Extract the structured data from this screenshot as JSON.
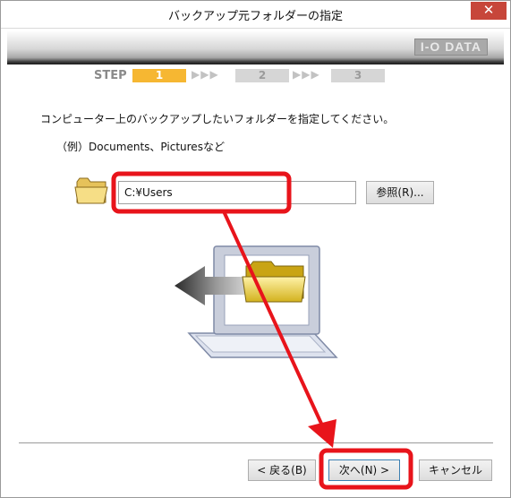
{
  "window": {
    "title": "バックアップ元フォルダーの指定",
    "close_label": "✕"
  },
  "banner": {
    "logo_text": "I-O DATA"
  },
  "steps": {
    "label": "STEP",
    "items": [
      "1",
      "2",
      "3"
    ],
    "arrows": "▶▶▶",
    "current": "1"
  },
  "content": {
    "instruction": "コンピューター上のバックアップしたいフォルダーを指定してください。",
    "example": "（例）Documents、Picturesなど",
    "path_value": "C:¥Users",
    "browse_label": "参照(R)..."
  },
  "footer": {
    "back_label": "< 戻る(B)",
    "next_label": "次へ(N) >",
    "cancel_label": "キャンセル"
  },
  "colors": {
    "step_active": "#f6b732",
    "step_inactive": "#d6d6d6",
    "annotation_red": "#e8141b",
    "close_red": "#c7463a"
  },
  "icons": [
    "folder-icon",
    "close-icon",
    "step-arrow-icon"
  ]
}
